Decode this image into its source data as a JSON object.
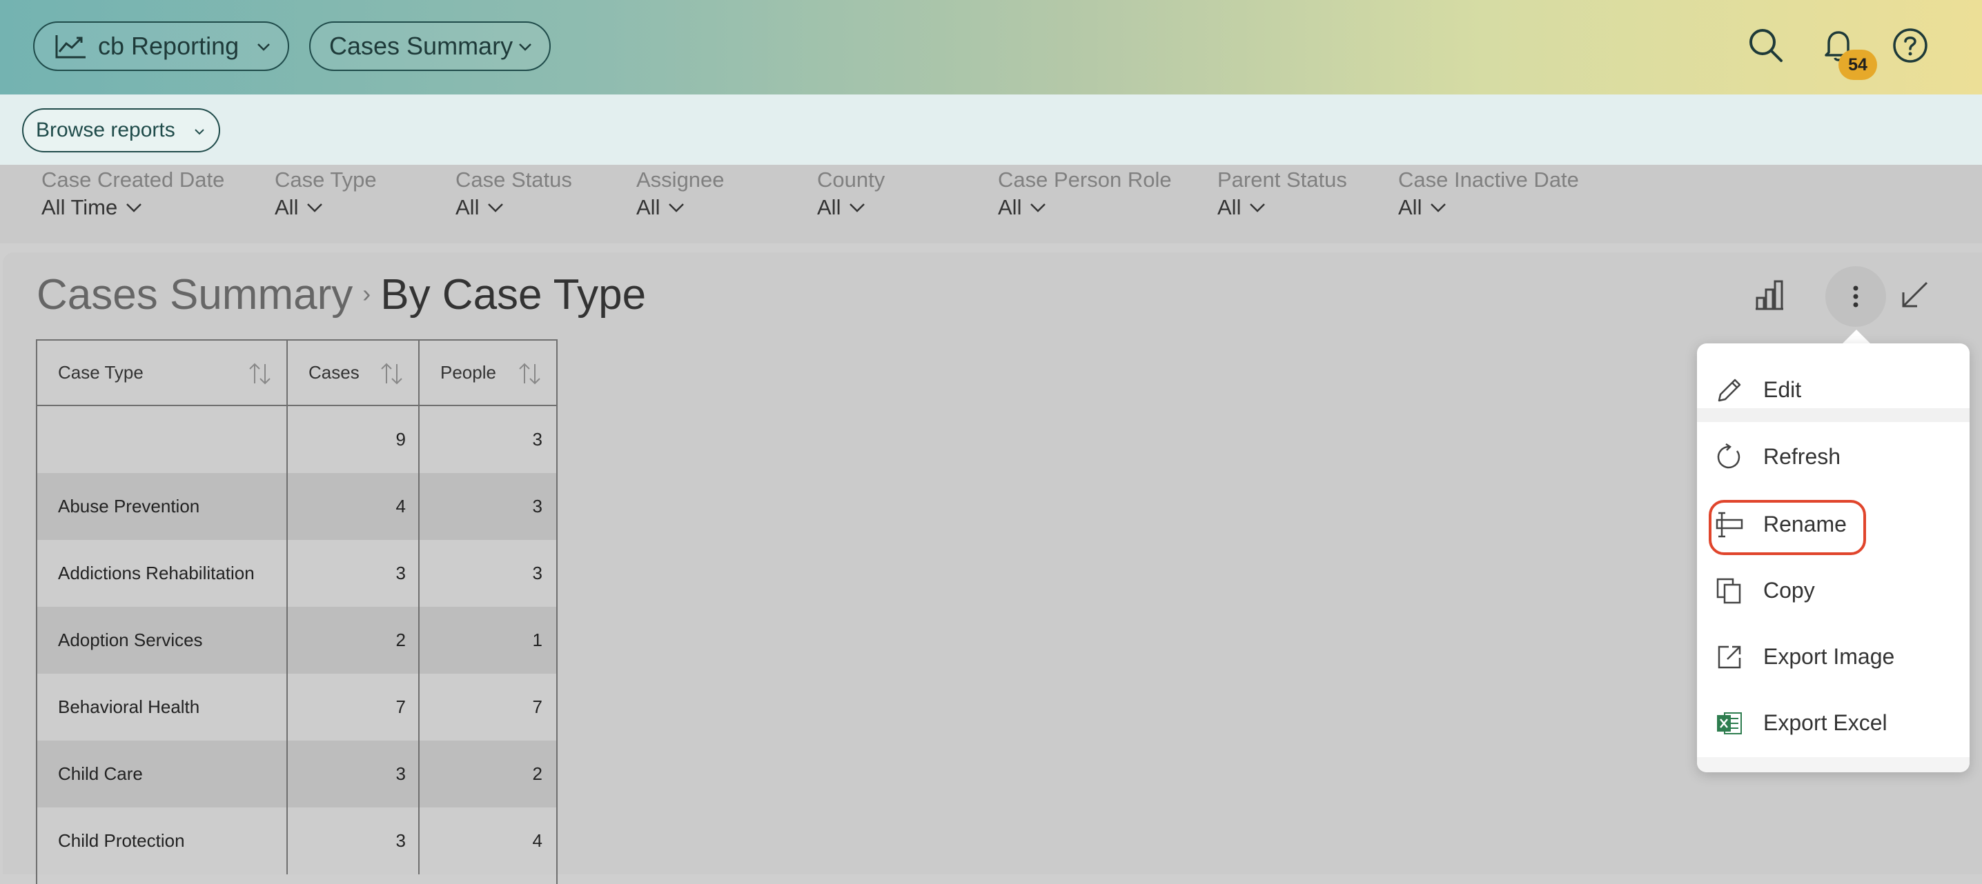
{
  "topbar": {
    "app_label": "cb Reporting",
    "report_label": "Cases Summary",
    "notification_count": "54"
  },
  "browse": {
    "label": "Browse reports"
  },
  "filters": [
    {
      "label": "Case Created Date",
      "value": "All Time"
    },
    {
      "label": "Case Type",
      "value": "All"
    },
    {
      "label": "Case Status",
      "value": "All"
    },
    {
      "label": "Assignee",
      "value": "All"
    },
    {
      "label": "County",
      "value": "All"
    },
    {
      "label": "Case Person Role",
      "value": "All"
    },
    {
      "label": "Parent Status",
      "value": "All"
    },
    {
      "label": "Case Inactive Date",
      "value": "All"
    }
  ],
  "breadcrumb": {
    "parent": "Cases Summary",
    "separator": "›",
    "current": "By Case Type"
  },
  "table": {
    "columns": [
      "Case Type",
      "Cases",
      "People"
    ],
    "rows": [
      {
        "case_type": "",
        "cases": "9",
        "people": "3"
      },
      {
        "case_type": "Abuse Prevention",
        "cases": "4",
        "people": "3"
      },
      {
        "case_type": "Addictions Rehabilitation",
        "cases": "3",
        "people": "3"
      },
      {
        "case_type": "Adoption Services",
        "cases": "2",
        "people": "1"
      },
      {
        "case_type": "Behavioral Health",
        "cases": "7",
        "people": "7"
      },
      {
        "case_type": "Child Care",
        "cases": "3",
        "people": "2"
      },
      {
        "case_type": "Child Protection",
        "cases": "3",
        "people": "4"
      }
    ]
  },
  "menu": {
    "items": [
      {
        "label": "Edit",
        "icon": "pencil-icon"
      },
      {
        "label": "Refresh",
        "icon": "refresh-icon"
      },
      {
        "label": "Rename",
        "icon": "rename-icon",
        "highlighted": true
      },
      {
        "label": "Copy",
        "icon": "copy-icon"
      },
      {
        "label": "Export Image",
        "icon": "export-image-icon"
      },
      {
        "label": "Export Excel",
        "icon": "excel-icon"
      }
    ],
    "highlight_color": "#e0452c"
  },
  "colors": {
    "topbar_gradient_start": "#74b3b1",
    "topbar_gradient_end": "#ecdf97",
    "badge": "#e6a92a",
    "excel_green": "#2e7d4f"
  }
}
